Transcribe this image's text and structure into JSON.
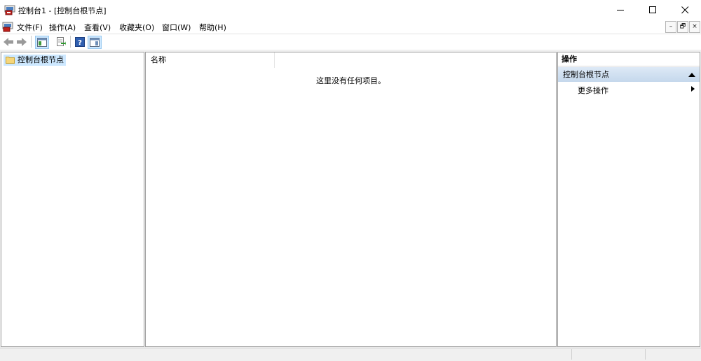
{
  "window": {
    "title": "控制台1 - [控制台根节点]"
  },
  "menubar": {
    "items": [
      "文件(F)",
      "操作(A)",
      "查看(V)",
      "收藏夹(O)",
      "窗口(W)",
      "帮助(H)"
    ],
    "mdi_buttons": [
      "–",
      "🗗",
      "×"
    ]
  },
  "icons": {
    "app": "console-icon",
    "back": "back-arrow-icon",
    "forward": "forward-arrow-icon",
    "show_hide_tree": "show-hide-tree-icon",
    "export": "export-list-icon",
    "help": "help-icon",
    "show_hide_action": "show-hide-action-pane-icon",
    "folder": "folder-icon"
  },
  "tree": {
    "root_label": "控制台根节点"
  },
  "list": {
    "column_name": "名称",
    "empty_message": "这里没有任何项目。"
  },
  "actions": {
    "title": "操作",
    "section_label": "控制台根节点",
    "more_actions": "更多操作"
  },
  "colors": {
    "selection": "#cde8ff",
    "section_header": "#c5d8ec",
    "pane_border": "#a0a0a0"
  }
}
